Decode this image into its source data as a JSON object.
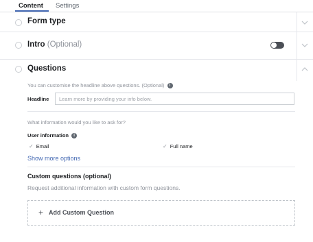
{
  "tabs": [
    {
      "label": "Content",
      "active": true
    },
    {
      "label": "Settings",
      "active": false
    }
  ],
  "sections": {
    "form_type": {
      "title": "Form type"
    },
    "intro": {
      "title": "Intro",
      "optional": "(Optional)",
      "toggle_on": false
    },
    "questions": {
      "title": "Questions",
      "expanded": true
    }
  },
  "questions": {
    "headline_hint": "You can customise the headline above questions. (Optional)",
    "headline_label": "Headline",
    "headline_value": "",
    "headline_placeholder": "Learn more by providing your info below.",
    "ask_hint": "What information would you like to ask for?",
    "user_info_label": "User information",
    "fields": [
      {
        "label": "Email",
        "checked": true
      },
      {
        "label": "Full name",
        "checked": true
      }
    ],
    "show_more": "Show more options",
    "custom_title": "Custom questions (optional)",
    "custom_subtitle": "Request additional information with custom form questions.",
    "add_custom_label": "Add Custom Question"
  },
  "colors": {
    "accent": "#4267b2",
    "toggle_off": "#4b4f56",
    "muted_text": "#90949c",
    "divider": "#e4e6eb"
  },
  "icons": {
    "info": "info-icon",
    "collapse": "chevron-up-icon",
    "expand": "chevron-down-icon",
    "add": "plus-icon",
    "check": "checkmark-icon"
  }
}
